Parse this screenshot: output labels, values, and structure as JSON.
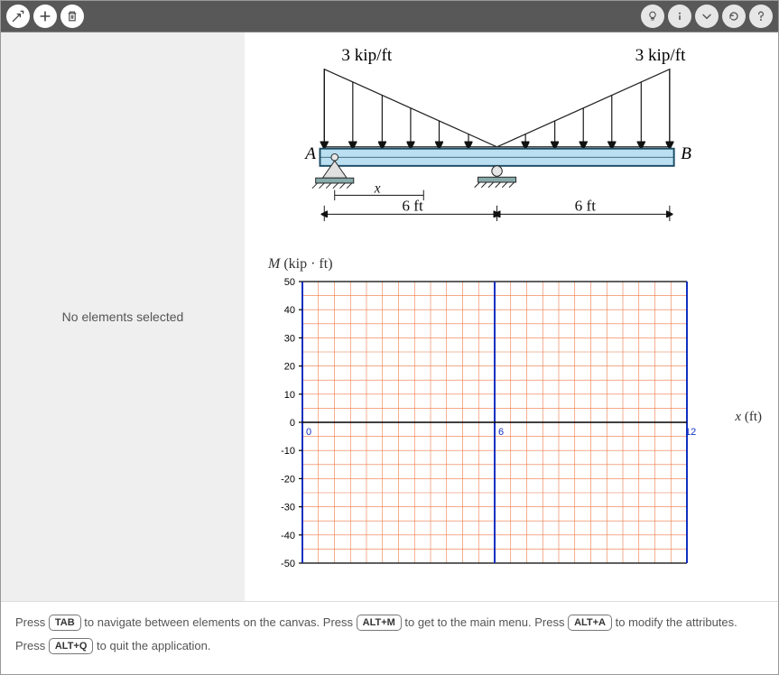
{
  "toolbar": {
    "left_buttons": [
      "vector-tool",
      "add",
      "delete"
    ],
    "right_buttons": [
      "hint-bulb",
      "info",
      "expand",
      "reload",
      "help"
    ]
  },
  "sidebar": {
    "empty_message": "No elements selected"
  },
  "diagram": {
    "left_label_A": "A",
    "right_label_B": "B",
    "x_label": "x",
    "load_left": "3 kip/ft",
    "load_right": "3 kip/ft",
    "span_left": "6 ft",
    "span_right": "6 ft"
  },
  "chart_data": {
    "type": "grid",
    "title_var": "M",
    "title_unit": " (kip · ft)",
    "xlabel_var": "x",
    "xlabel_unit": " (ft)",
    "xlim": [
      0,
      12
    ],
    "ylim": [
      -50,
      50
    ],
    "x_ticks": [
      0,
      6,
      12
    ],
    "y_ticks": [
      -50,
      -40,
      -30,
      -20,
      -10,
      0,
      10,
      20,
      30,
      40,
      50
    ],
    "x_minor_step": 0.5,
    "y_minor_step": 5,
    "series": []
  },
  "hints": {
    "line1_a": "Press ",
    "line1_key1": "TAB",
    "line1_b": " to navigate between elements on the canvas. Press ",
    "line1_key2": "ALT+M",
    "line1_c": " to get to the main menu. Press ",
    "line1_key3": "ALT+A",
    "line1_d": " to modify the attributes.",
    "line2_a": "Press ",
    "line2_key1": "ALT+Q",
    "line2_b": " to quit the application."
  }
}
